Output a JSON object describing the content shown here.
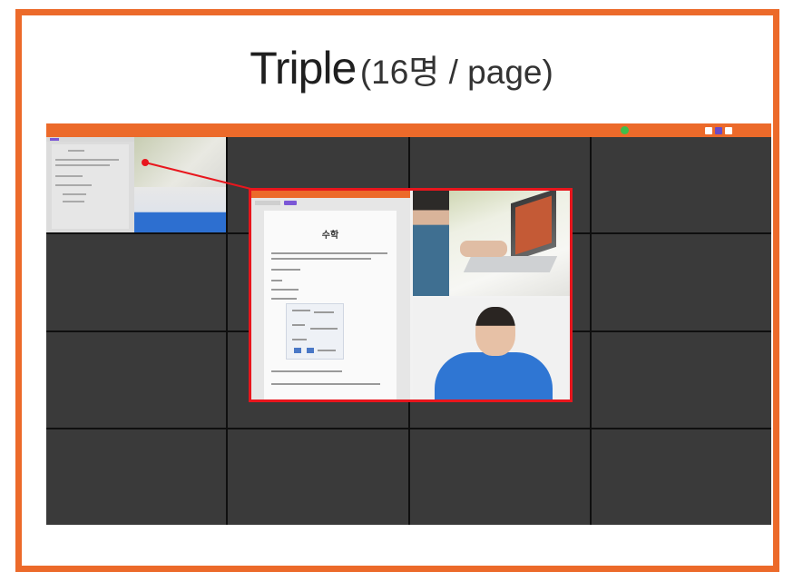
{
  "title": {
    "main": "Triple",
    "sub": "(16명 / page)"
  },
  "colors": {
    "accent": "#ec6a2a",
    "highlight": "#e8161d",
    "tile": "#3a3a3a"
  },
  "screen": {
    "grid": {
      "rows": 4,
      "cols": 4
    },
    "popup_title": "수학"
  }
}
